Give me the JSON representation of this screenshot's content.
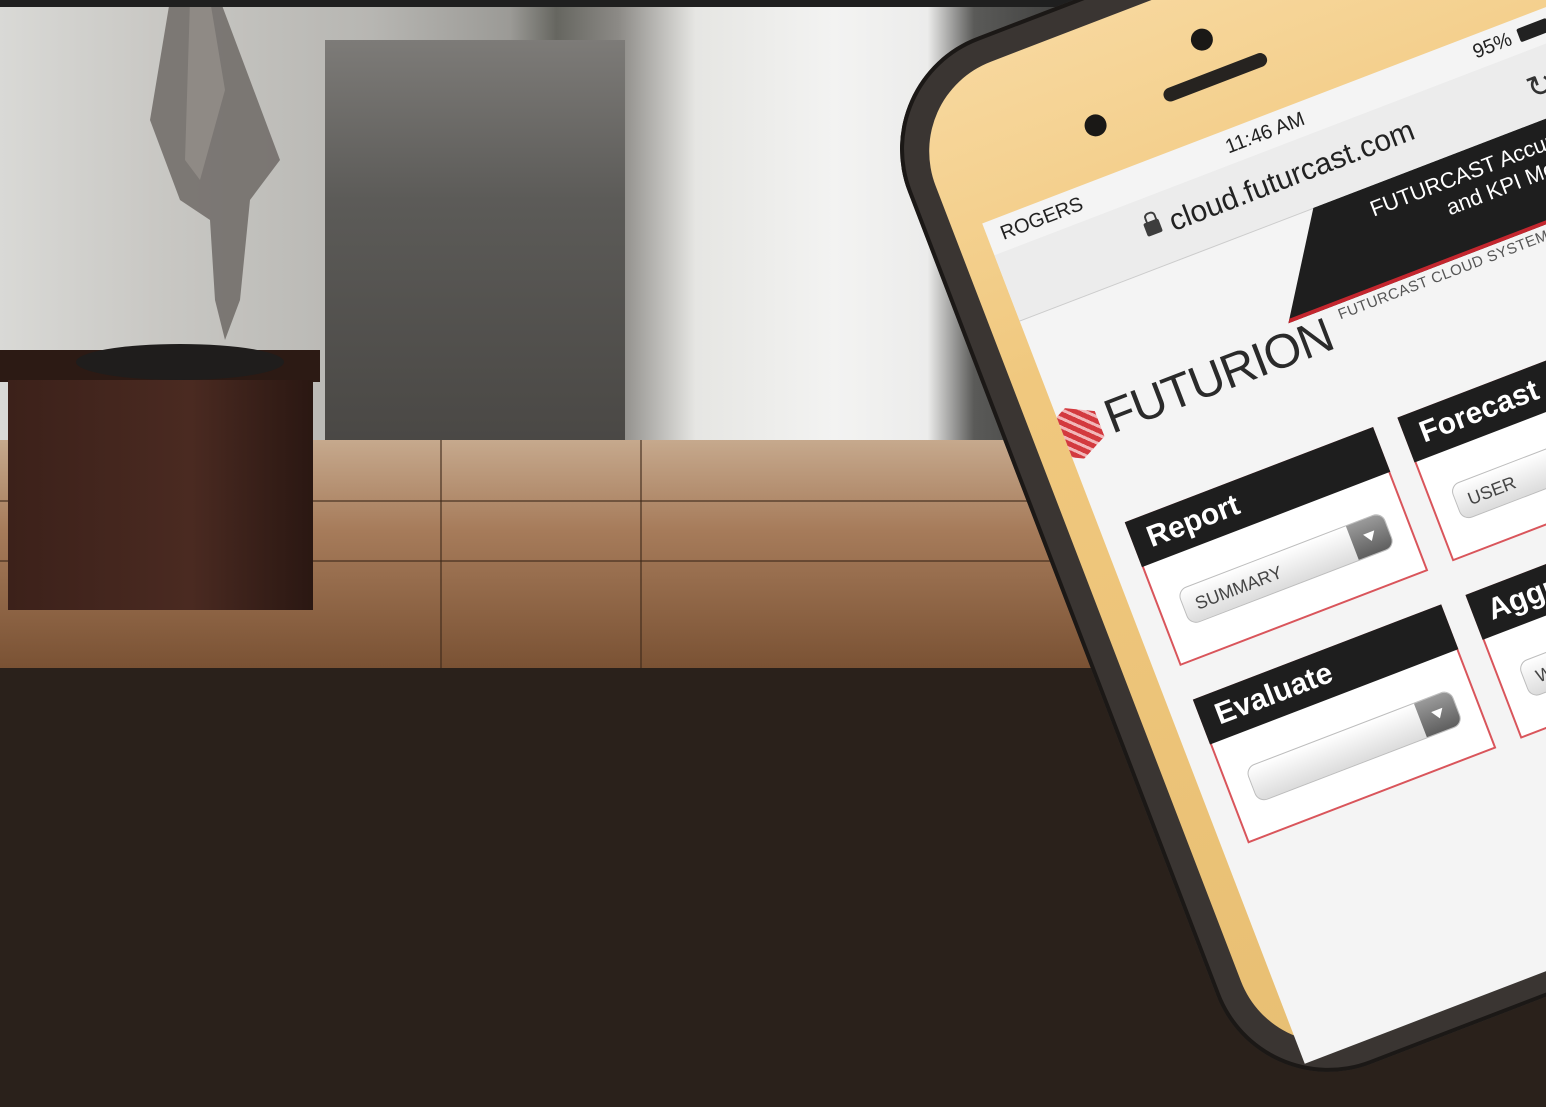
{
  "phone": {
    "status": {
      "carrier": "ROGERS",
      "time": "11:46 AM",
      "battery": "95%"
    },
    "browser": {
      "url": "cloud.futurcast.com"
    },
    "app": {
      "banner_line1": "FUTURCAST Accuracy",
      "banner_line2": "and KPI Module",
      "subtitle": "FUTURCAST CLOUD SYSTEM",
      "logo_text": "FUTURION",
      "panels": [
        {
          "title": "Report",
          "value": "SUMMARY"
        },
        {
          "title": "Forecast",
          "value": "USER"
        },
        {
          "title": "Evaluate",
          "value": ""
        },
        {
          "title": "Aggregation",
          "value": "WEIGHTED"
        }
      ]
    }
  },
  "colors": {
    "accent": "#c3262e",
    "header_dark": "#1e1e1e",
    "bezel_gold": "#f0c87e"
  }
}
